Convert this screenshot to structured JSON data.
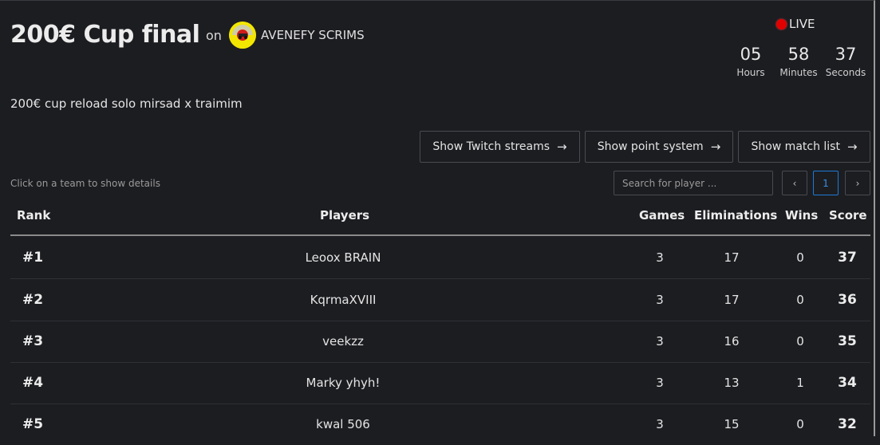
{
  "tournament": {
    "title": "200€ Cup final",
    "on_label": "on",
    "organizer": "AVENEFY SCRIMS",
    "description": "200€ cup reload solo mirsad x traimim"
  },
  "live": {
    "label": "LIVE",
    "hours": "05",
    "hours_label": "Hours",
    "minutes": "58",
    "minutes_label": "Minutes",
    "seconds": "37",
    "seconds_label": "Seconds"
  },
  "actions": {
    "twitch": "Show Twitch streams",
    "points": "Show point system",
    "matches": "Show match list"
  },
  "hint": "Click on a team to show details",
  "search": {
    "placeholder": "Search for player ..."
  },
  "pagination": {
    "prev": "‹",
    "current": "1",
    "next": "›"
  },
  "table": {
    "headers": {
      "rank": "Rank",
      "players": "Players",
      "games": "Games",
      "eliminations": "Eliminations",
      "wins": "Wins",
      "score": "Score"
    },
    "rows": [
      {
        "rank": "#1",
        "player": "Leoox BRAIN",
        "games": "3",
        "eliminations": "17",
        "wins": "0",
        "score": "37"
      },
      {
        "rank": "#2",
        "player": "KqrmaXVIII",
        "games": "3",
        "eliminations": "17",
        "wins": "0",
        "score": "36"
      },
      {
        "rank": "#3",
        "player": "veekzz",
        "games": "3",
        "eliminations": "16",
        "wins": "0",
        "score": "35"
      },
      {
        "rank": "#4",
        "player": "Marky yhyh!",
        "games": "3",
        "eliminations": "13",
        "wins": "1",
        "score": "34"
      },
      {
        "rank": "#5",
        "player": "kwal 506",
        "games": "3",
        "eliminations": "15",
        "wins": "0",
        "score": "32"
      }
    ]
  },
  "colors": {
    "background": "#1c1d21",
    "live_dot": "#e00000",
    "accent": "#1e7ad6",
    "logo_yellow": "#f2e600"
  }
}
